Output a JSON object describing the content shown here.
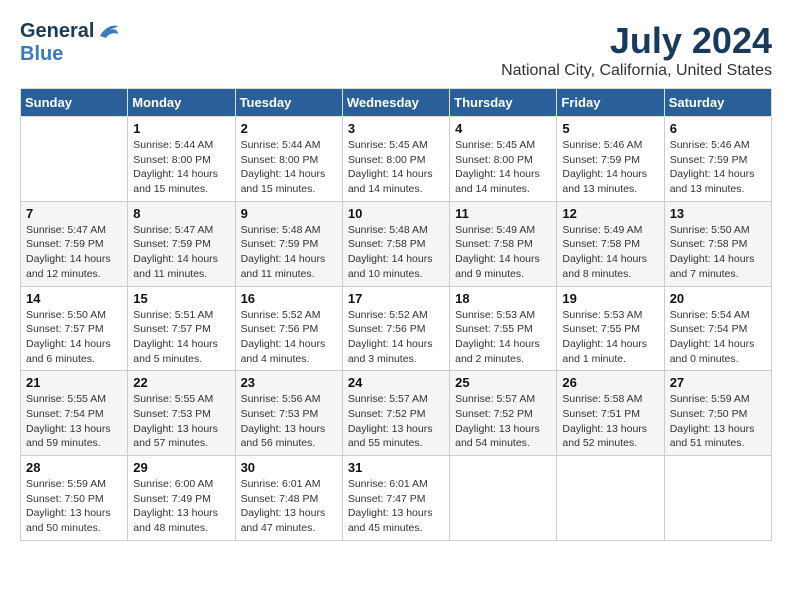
{
  "header": {
    "logo_general": "General",
    "logo_blue": "Blue",
    "month": "July 2024",
    "location": "National City, California, United States"
  },
  "columns": [
    "Sunday",
    "Monday",
    "Tuesday",
    "Wednesday",
    "Thursday",
    "Friday",
    "Saturday"
  ],
  "weeks": [
    [
      {
        "day": "",
        "info": ""
      },
      {
        "day": "1",
        "info": "Sunrise: 5:44 AM\nSunset: 8:00 PM\nDaylight: 14 hours\nand 15 minutes."
      },
      {
        "day": "2",
        "info": "Sunrise: 5:44 AM\nSunset: 8:00 PM\nDaylight: 14 hours\nand 15 minutes."
      },
      {
        "day": "3",
        "info": "Sunrise: 5:45 AM\nSunset: 8:00 PM\nDaylight: 14 hours\nand 14 minutes."
      },
      {
        "day": "4",
        "info": "Sunrise: 5:45 AM\nSunset: 8:00 PM\nDaylight: 14 hours\nand 14 minutes."
      },
      {
        "day": "5",
        "info": "Sunrise: 5:46 AM\nSunset: 7:59 PM\nDaylight: 14 hours\nand 13 minutes."
      },
      {
        "day": "6",
        "info": "Sunrise: 5:46 AM\nSunset: 7:59 PM\nDaylight: 14 hours\nand 13 minutes."
      }
    ],
    [
      {
        "day": "7",
        "info": "Sunrise: 5:47 AM\nSunset: 7:59 PM\nDaylight: 14 hours\nand 12 minutes."
      },
      {
        "day": "8",
        "info": "Sunrise: 5:47 AM\nSunset: 7:59 PM\nDaylight: 14 hours\nand 11 minutes."
      },
      {
        "day": "9",
        "info": "Sunrise: 5:48 AM\nSunset: 7:59 PM\nDaylight: 14 hours\nand 11 minutes."
      },
      {
        "day": "10",
        "info": "Sunrise: 5:48 AM\nSunset: 7:58 PM\nDaylight: 14 hours\nand 10 minutes."
      },
      {
        "day": "11",
        "info": "Sunrise: 5:49 AM\nSunset: 7:58 PM\nDaylight: 14 hours\nand 9 minutes."
      },
      {
        "day": "12",
        "info": "Sunrise: 5:49 AM\nSunset: 7:58 PM\nDaylight: 14 hours\nand 8 minutes."
      },
      {
        "day": "13",
        "info": "Sunrise: 5:50 AM\nSunset: 7:58 PM\nDaylight: 14 hours\nand 7 minutes."
      }
    ],
    [
      {
        "day": "14",
        "info": "Sunrise: 5:50 AM\nSunset: 7:57 PM\nDaylight: 14 hours\nand 6 minutes."
      },
      {
        "day": "15",
        "info": "Sunrise: 5:51 AM\nSunset: 7:57 PM\nDaylight: 14 hours\nand 5 minutes."
      },
      {
        "day": "16",
        "info": "Sunrise: 5:52 AM\nSunset: 7:56 PM\nDaylight: 14 hours\nand 4 minutes."
      },
      {
        "day": "17",
        "info": "Sunrise: 5:52 AM\nSunset: 7:56 PM\nDaylight: 14 hours\nand 3 minutes."
      },
      {
        "day": "18",
        "info": "Sunrise: 5:53 AM\nSunset: 7:55 PM\nDaylight: 14 hours\nand 2 minutes."
      },
      {
        "day": "19",
        "info": "Sunrise: 5:53 AM\nSunset: 7:55 PM\nDaylight: 14 hours\nand 1 minute."
      },
      {
        "day": "20",
        "info": "Sunrise: 5:54 AM\nSunset: 7:54 PM\nDaylight: 14 hours\nand 0 minutes."
      }
    ],
    [
      {
        "day": "21",
        "info": "Sunrise: 5:55 AM\nSunset: 7:54 PM\nDaylight: 13 hours\nand 59 minutes."
      },
      {
        "day": "22",
        "info": "Sunrise: 5:55 AM\nSunset: 7:53 PM\nDaylight: 13 hours\nand 57 minutes."
      },
      {
        "day": "23",
        "info": "Sunrise: 5:56 AM\nSunset: 7:53 PM\nDaylight: 13 hours\nand 56 minutes."
      },
      {
        "day": "24",
        "info": "Sunrise: 5:57 AM\nSunset: 7:52 PM\nDaylight: 13 hours\nand 55 minutes."
      },
      {
        "day": "25",
        "info": "Sunrise: 5:57 AM\nSunset: 7:52 PM\nDaylight: 13 hours\nand 54 minutes."
      },
      {
        "day": "26",
        "info": "Sunrise: 5:58 AM\nSunset: 7:51 PM\nDaylight: 13 hours\nand 52 minutes."
      },
      {
        "day": "27",
        "info": "Sunrise: 5:59 AM\nSunset: 7:50 PM\nDaylight: 13 hours\nand 51 minutes."
      }
    ],
    [
      {
        "day": "28",
        "info": "Sunrise: 5:59 AM\nSunset: 7:50 PM\nDaylight: 13 hours\nand 50 minutes."
      },
      {
        "day": "29",
        "info": "Sunrise: 6:00 AM\nSunset: 7:49 PM\nDaylight: 13 hours\nand 48 minutes."
      },
      {
        "day": "30",
        "info": "Sunrise: 6:01 AM\nSunset: 7:48 PM\nDaylight: 13 hours\nand 47 minutes."
      },
      {
        "day": "31",
        "info": "Sunrise: 6:01 AM\nSunset: 7:47 PM\nDaylight: 13 hours\nand 45 minutes."
      },
      {
        "day": "",
        "info": ""
      },
      {
        "day": "",
        "info": ""
      },
      {
        "day": "",
        "info": ""
      }
    ]
  ]
}
